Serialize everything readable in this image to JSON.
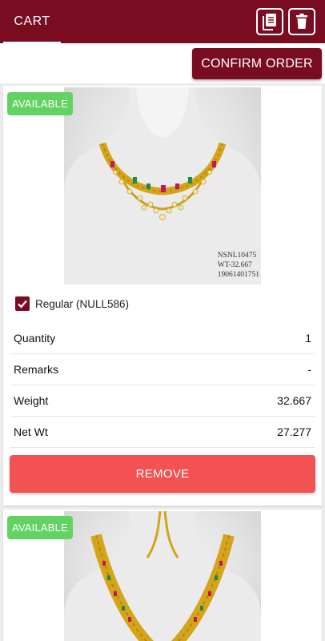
{
  "header": {
    "tab_label": "CART",
    "actions": [
      {
        "icon": "order-list-icon"
      },
      {
        "icon": "trash-icon"
      }
    ]
  },
  "toolbar": {
    "confirm_label": "CONFIRM ORDER"
  },
  "items": [
    {
      "status": "AVAILABLE",
      "image_stamp": [
        "NSNL10475",
        "WT-32.667",
        "19061401751"
      ],
      "option_checked": true,
      "option_label": "Regular (NULL586)",
      "details": [
        {
          "label": "Quantity",
          "value": "1"
        },
        {
          "label": "Remarks",
          "value": "-"
        },
        {
          "label": "Weight",
          "value": "32.667"
        },
        {
          "label": "Net Wt",
          "value": "27.277"
        }
      ],
      "remove_label": "REMOVE"
    },
    {
      "status": "AVAILABLE"
    }
  ],
  "colors": {
    "primary": "#7a0c22",
    "available": "#62d262",
    "remove": "#f25252"
  }
}
